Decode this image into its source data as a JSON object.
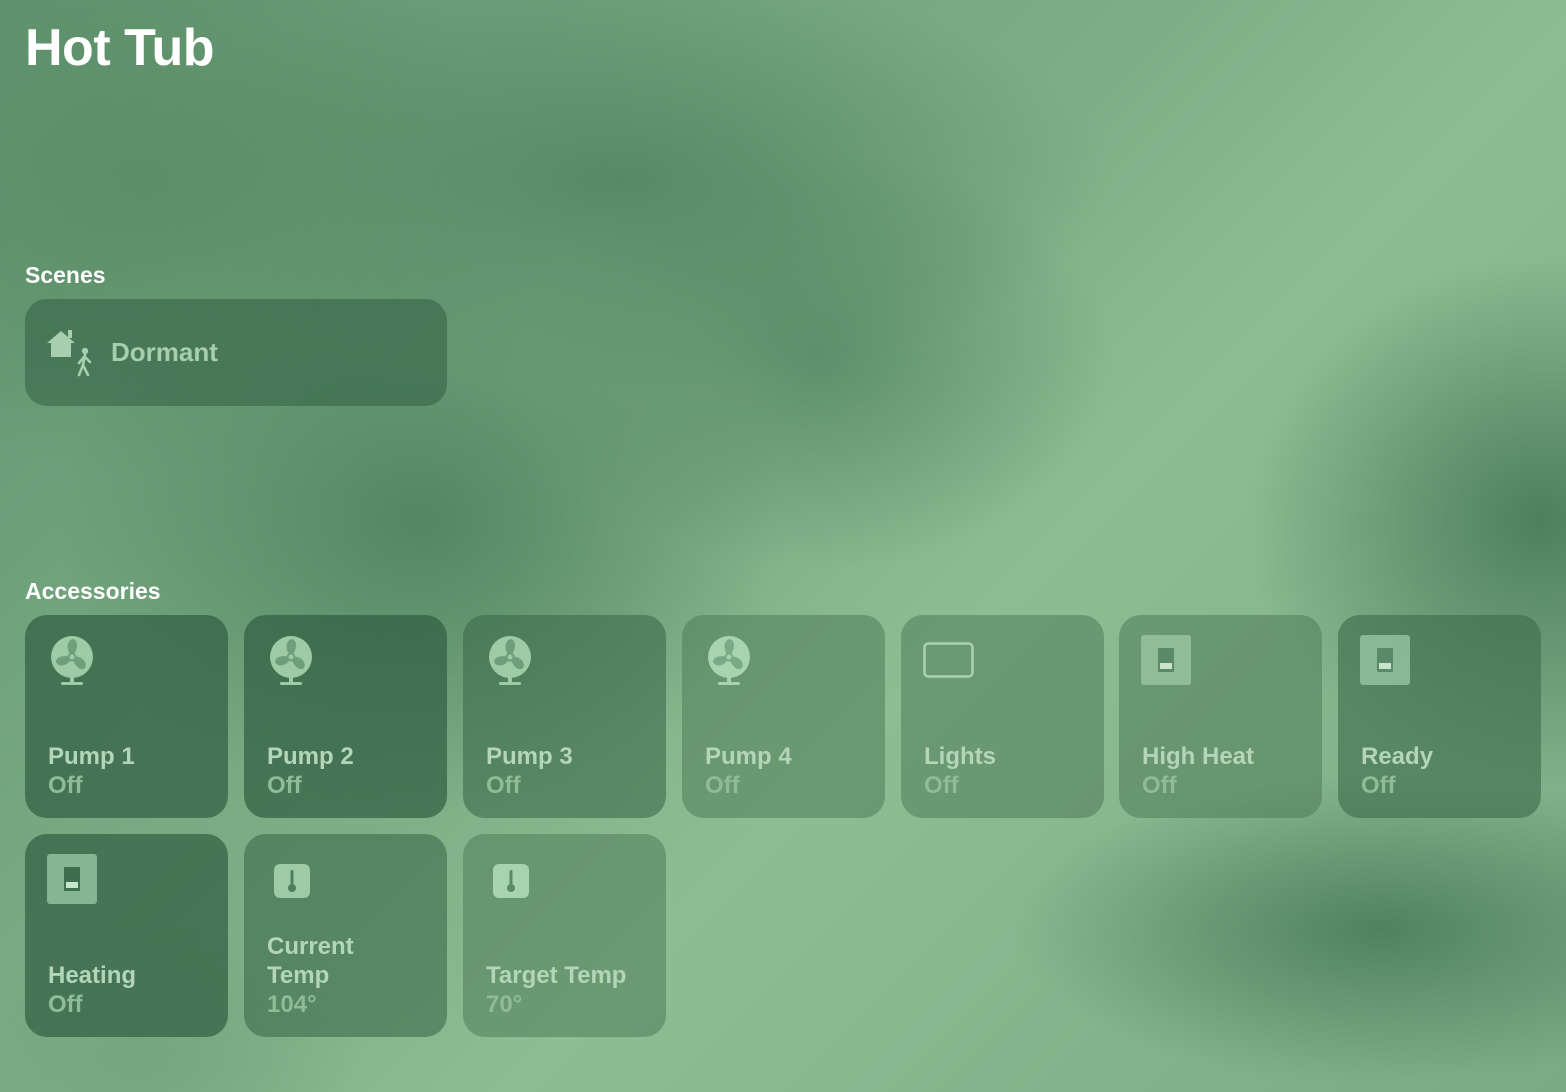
{
  "header": {
    "title": "Hot Tub"
  },
  "scenes": {
    "title": "Scenes",
    "items": [
      {
        "label": "Dormant",
        "icon": "home-person-icon"
      }
    ]
  },
  "accessories": {
    "title": "Accessories",
    "items": [
      {
        "name": "Pump 1",
        "status": "Off",
        "icon": "fan-icon"
      },
      {
        "name": "Pump 2",
        "status": "Off",
        "icon": "fan-icon"
      },
      {
        "name": "Pump 3",
        "status": "Off",
        "icon": "fan-icon"
      },
      {
        "name": "Pump 4",
        "status": "Off",
        "icon": "fan-icon"
      },
      {
        "name": "Lights",
        "status": "Off",
        "icon": "light-strip-icon"
      },
      {
        "name": "High Heat",
        "status": "Off",
        "icon": "switch-icon"
      },
      {
        "name": "Ready",
        "status": "Off",
        "icon": "switch-icon"
      },
      {
        "name": "Heating",
        "status": "Off",
        "icon": "switch-icon"
      },
      {
        "name": "Current Temp",
        "status": "104°",
        "icon": "thermometer-icon"
      },
      {
        "name": "Target Temp",
        "status": "70°",
        "icon": "thermometer-icon"
      }
    ]
  },
  "colors": {
    "tile_text": "#b3d5b8",
    "tile_status": "#8fbb97",
    "scene_text": "#a7cfae",
    "background": "#7fae86"
  }
}
